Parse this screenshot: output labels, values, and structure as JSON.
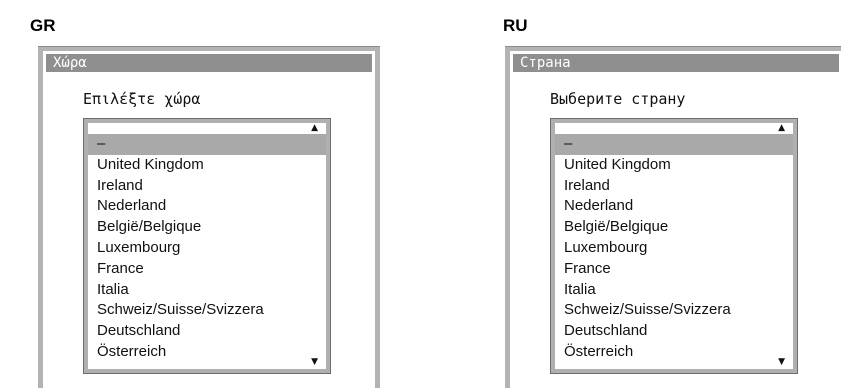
{
  "panels": [
    {
      "code": "GR",
      "title": "Χώρα",
      "prompt": "Επιλέξτε χώρα",
      "selected_index": 0,
      "items": [
        "–",
        "United Kingdom",
        "Ireland",
        "Nederland",
        "België/Belgique",
        "Luxembourg",
        "France",
        "Italia",
        "Schweiz/Suisse/Svizzera",
        "Deutschland",
        "Österreich"
      ],
      "scroll_up_icon": "triangle-up",
      "scroll_down_icon": "triangle-down"
    },
    {
      "code": "RU",
      "title": "Страна",
      "prompt": "Выберите страну",
      "selected_index": 0,
      "items": [
        "–",
        "United Kingdom",
        "Ireland",
        "Nederland",
        "België/Belgique",
        "Luxembourg",
        "France",
        "Italia",
        "Schweiz/Suisse/Svizzera",
        "Deutschland",
        "Österreich"
      ],
      "scroll_up_icon": "triangle-up",
      "scroll_down_icon": "triangle-down"
    }
  ],
  "colors": {
    "frame": "#b3b3b3",
    "title_bar": "#8f8f8f",
    "selection": "#a9a9a9"
  }
}
